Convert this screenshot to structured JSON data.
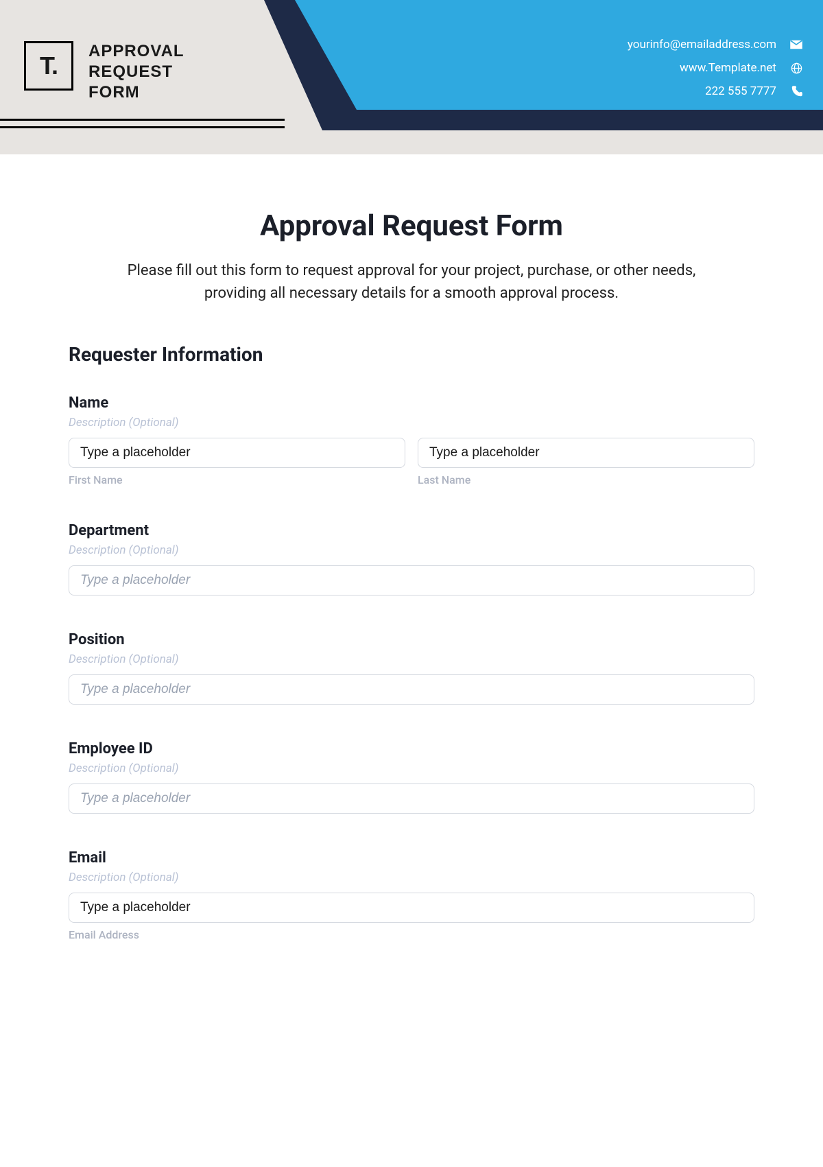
{
  "header": {
    "logo_text": "T.",
    "title_line1": "APPROVAL",
    "title_line2": "REQUEST",
    "title_line3": "FORM",
    "contact": {
      "email": "yourinfo@emailaddress.com",
      "website": "www.Template.net",
      "phone": "222 555 7777"
    }
  },
  "form": {
    "title": "Approval Request Form",
    "intro": "Please fill out this form to request approval for your project, purchase, or other needs, providing all necessary details for a smooth approval process.",
    "section_heading": "Requester Information",
    "fields": {
      "name": {
        "label": "Name",
        "desc": "Description (Optional)",
        "first_value": "Type a placeholder",
        "first_sub": "First Name",
        "last_value": "Type a placeholder",
        "last_sub": "Last Name"
      },
      "department": {
        "label": "Department",
        "desc": "Description (Optional)",
        "placeholder": "Type a placeholder"
      },
      "position": {
        "label": "Position",
        "desc": "Description (Optional)",
        "placeholder": "Type a placeholder"
      },
      "employee_id": {
        "label": "Employee ID",
        "desc": "Description (Optional)",
        "placeholder": "Type a placeholder"
      },
      "email": {
        "label": "Email",
        "desc": "Description (Optional)",
        "value": "Type a placeholder",
        "sub": "Email Address"
      }
    }
  }
}
